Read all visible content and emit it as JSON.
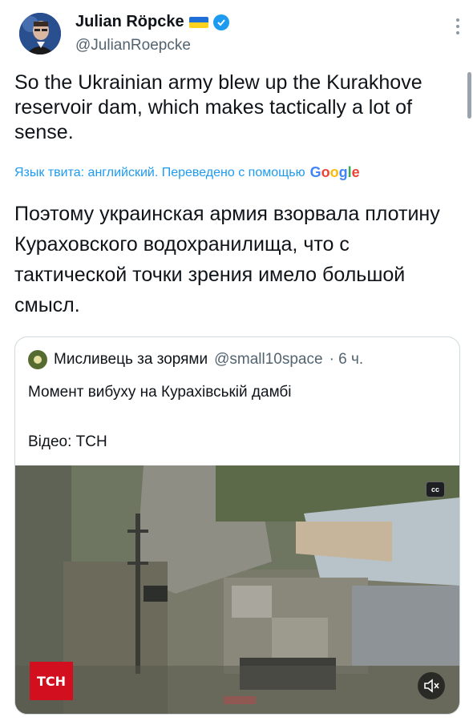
{
  "author": {
    "name": "Julian Röpcke",
    "handle": "@JulianRoepcke"
  },
  "tweet": {
    "text": "So the Ukrainian army blew up the Kurakhove reservoir dam, which makes tactically a lot of sense."
  },
  "translation": {
    "note": "Язык твита: английский. Переведено с помощью",
    "provider": "Google",
    "text": "Поэтому украинская армия взорвала плотину Кураховского водохранилища, что с тактической точки зрения имело большой смысл."
  },
  "quoted": {
    "name": "Мисливець за зорями",
    "handle": "@small10space",
    "time": "· 6 ч.",
    "line1": "Момент вибуху на Курахівській дамбі",
    "line2": "Відео: ТСН",
    "video": {
      "cc_label": "cc",
      "watermark": "ТСН"
    }
  },
  "icons": [
    "more-icon",
    "verified-badge-icon",
    "ukraine-flag-icon",
    "closed-captions-icon",
    "mute-icon",
    "google-logo"
  ],
  "colors": {
    "accent": "#1d9bf0",
    "secondary_text": "#536471",
    "tsn_red": "#d10f1f"
  }
}
